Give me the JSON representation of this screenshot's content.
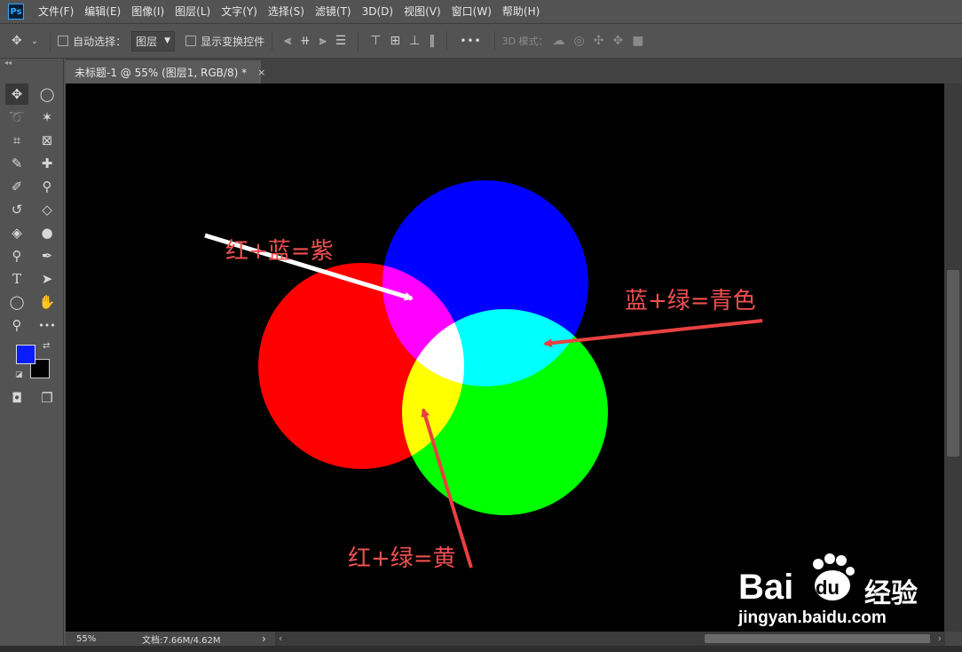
{
  "app": {
    "logo": "Ps"
  },
  "menu": [
    "文件(F)",
    "编辑(E)",
    "图像(I)",
    "图层(L)",
    "文字(Y)",
    "选择(S)",
    "滤镜(T)",
    "3D(D)",
    "视图(V)",
    "窗口(W)",
    "帮助(H)"
  ],
  "options": {
    "auto_select_label": "自动选择：",
    "layer_select_value": "图层",
    "show_transform_label": "显示变换控件",
    "more": "•••",
    "mode_3d_label": "3D 模式："
  },
  "document": {
    "tab_title": "未标题-1 @ 55% (图层1, RGB/8) *",
    "close": "×"
  },
  "canvas": {
    "circle_colors": {
      "red": "#ff0000",
      "green": "#00ff00",
      "blue": "#0000ff"
    },
    "labels": {
      "red_blue": "红+蓝=紫",
      "blue_green": "蓝+绿=青色",
      "red_green": "红+绿=黄"
    }
  },
  "status": {
    "zoom": "55%",
    "doc_info": "文档:7.66M/4.62M",
    "arrow": "›"
  },
  "colors": {
    "foreground": "#0a1cff",
    "background": "#000000"
  },
  "watermark": {
    "brand_left": "Bai",
    "brand_mid": "du",
    "brand_right": "经验",
    "url": "jingyan.baidu.com"
  }
}
